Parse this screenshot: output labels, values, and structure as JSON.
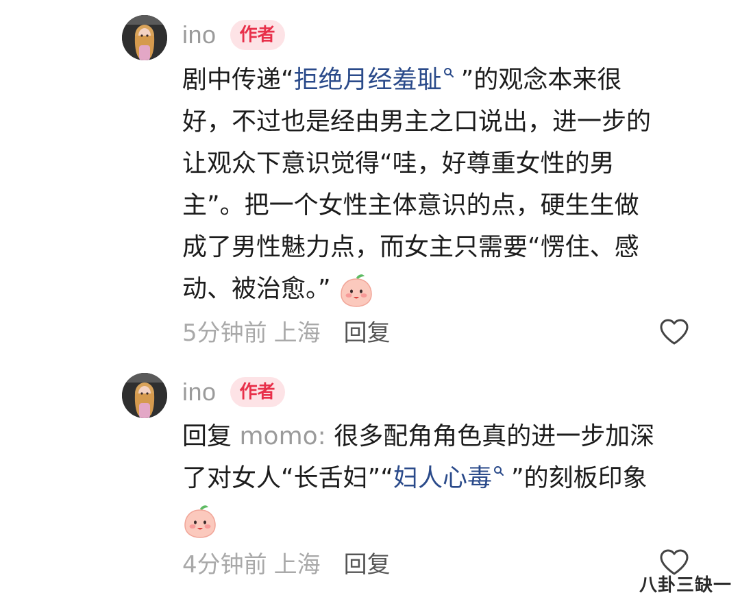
{
  "comments": [
    {
      "author": "ino",
      "badge": "作者",
      "text_lines": {
        "l1_before": "剧中传递“",
        "l1_link": "拒绝月经羞耻",
        "l1_after": "”的观念本来很",
        "l2": "好，不过也是经由男主之口说出，进一步的",
        "l3": "让观众下意识觉得“哇，好尊重女性的男",
        "l4": "主”。把一个女性主体意识的点，硬生生做",
        "l5": "成了男性魅力点，而女主只需要“愣住、感",
        "l6": "动、被治愈。”"
      },
      "time": "5分钟前",
      "location": "上海",
      "reply_label": "回复",
      "emoji_icon": "peach-smile-emoji-icon"
    },
    {
      "author": "ino",
      "badge": "作者",
      "text_lines": {
        "l1_reply": "回复",
        "l1_user": "momo:",
        "l1_text": "很多配角角色真的进一步加深",
        "l2_before": "了对女人“长舌妇”“",
        "l2_link": "妇人心毒",
        "l2_after": "”的刻板印象"
      },
      "time": "4分钟前",
      "location": "上海",
      "reply_label": "回复",
      "emoji_icon": "peach-smile-emoji-icon"
    }
  ],
  "watermark": "八卦三缺一",
  "colors": {
    "badge_bg": "#fde3e6",
    "badge_text": "#e8304a",
    "link": "#2a4a8a",
    "meta": "#a9a9a9"
  }
}
